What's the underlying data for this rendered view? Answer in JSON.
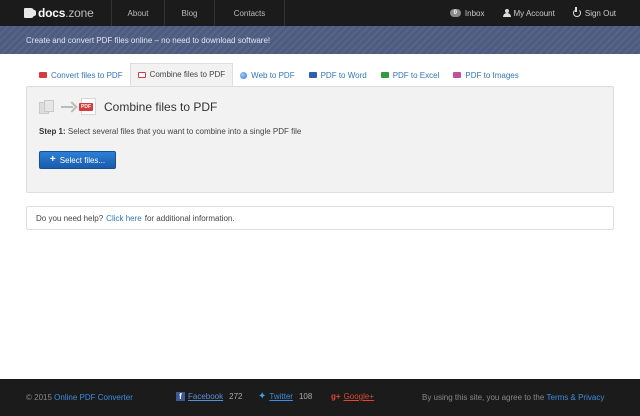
{
  "nav": {
    "brand_main": "docs",
    "brand_sub": ".zone",
    "links": [
      "About",
      "Blog",
      "Contacts"
    ],
    "inbox_count": "0",
    "inbox_label": "Inbox",
    "account_label": "My Account",
    "signout_label": "Sign Out"
  },
  "banner": {
    "text": "Create and convert PDF files online – no need to download software!"
  },
  "tabs": [
    {
      "label": "Convert files to PDF",
      "icon": "pdf-icon",
      "active": false
    },
    {
      "label": "Combine files to PDF",
      "icon": "combine-icon",
      "active": true
    },
    {
      "label": "Web to PDF",
      "icon": "globe-icon",
      "active": false
    },
    {
      "label": "PDF to Word",
      "icon": "word-icon",
      "active": false
    },
    {
      "label": "PDF to Excel",
      "icon": "excel-icon",
      "active": false
    },
    {
      "label": "PDF to Images",
      "icon": "images-icon",
      "active": false
    }
  ],
  "panel": {
    "title": "Combine files to PDF",
    "pdf_badge": "PDF",
    "step_label": "Step 1:",
    "step_text": "Select several files that you want to combine into a single PDF file",
    "button_plus": "+",
    "button_label": "Select files..."
  },
  "help": {
    "before": "Do you need help?",
    "link": "Click here",
    "after": "for additional information."
  },
  "footer": {
    "copyright": "© 2015",
    "site_link": "Online PDF Converter",
    "facebook_label": "Facebook",
    "facebook_count": "272",
    "twitter_label": "Twitter",
    "twitter_count": "108",
    "google_label": "Google+",
    "google_icon": "g+",
    "terms_before": "By using this site, you agree to the",
    "terms_link": "Terms & Privacy"
  },
  "colors": {
    "navbar": "#1b1b1b",
    "banner": "#4d5c80",
    "link": "#2e77c1",
    "button": "#1f6cc4"
  }
}
